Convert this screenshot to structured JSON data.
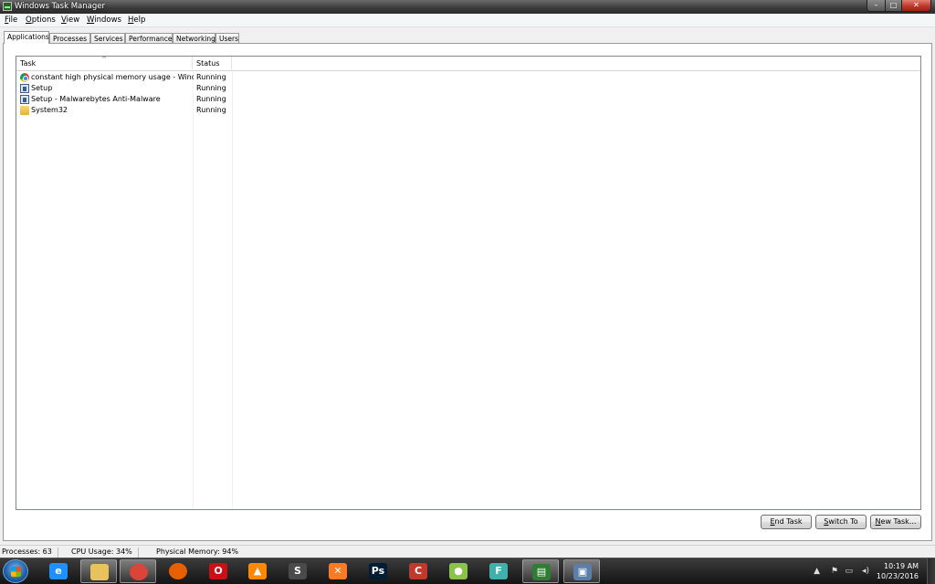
{
  "window": {
    "title": "Windows Task Manager",
    "controls": {
      "minimize": "–",
      "maximize": "□",
      "close": "✕"
    }
  },
  "menu": [
    "File",
    "Options",
    "View",
    "Windows",
    "Help"
  ],
  "tabs": [
    "Applications",
    "Processes",
    "Services",
    "Performance",
    "Networking",
    "Users"
  ],
  "active_tab": "Applications",
  "table": {
    "columns": [
      "Task",
      "Status"
    ],
    "sort_indicator": "^",
    "rows": [
      {
        "icon": "chrome-icon",
        "task": "constant high physical memory usage - Windows...",
        "status": "Running"
      },
      {
        "icon": "setup-icon",
        "task": "Setup",
        "status": "Running"
      },
      {
        "icon": "setup-icon",
        "task": "Setup - Malwarebytes Anti-Malware",
        "status": "Running"
      },
      {
        "icon": "folder-icon",
        "task": "System32",
        "status": "Running"
      }
    ]
  },
  "buttons": {
    "end_task": "End Task",
    "switch_to": "Switch To",
    "new_task": "New Task..."
  },
  "statusbar": {
    "processes": "Processes: 63",
    "cpu": "CPU Usage: 34%",
    "memory": "Physical Memory: 94%"
  },
  "taskbar": {
    "items": [
      {
        "name": "internet-explorer-icon",
        "glyph": "e",
        "color": "#1e90ff",
        "active": false
      },
      {
        "name": "file-explorer-icon",
        "glyph": "",
        "color": "#e8c25a",
        "active": true
      },
      {
        "name": "chrome-icon",
        "glyph": "",
        "color": "#db4437",
        "active": true
      },
      {
        "name": "firefox-icon",
        "glyph": "",
        "color": "#e66000",
        "active": false
      },
      {
        "name": "opera-icon",
        "glyph": "O",
        "color": "#cc0f16",
        "active": false
      },
      {
        "name": "vlc-icon",
        "glyph": "▲",
        "color": "#ff8800",
        "active": false
      },
      {
        "name": "sublime-text-icon",
        "glyph": "S",
        "color": "#4a4a4a",
        "active": false
      },
      {
        "name": "xampp-icon",
        "glyph": "✕",
        "color": "#fb7a24",
        "active": false
      },
      {
        "name": "photoshop-icon",
        "glyph": "Ps",
        "color": "#001d34",
        "active": false
      },
      {
        "name": "ccleaner-icon",
        "glyph": "C",
        "color": "#c0392b",
        "active": false
      },
      {
        "name": "app-green-icon",
        "glyph": "●",
        "color": "#8bc34a",
        "active": false
      },
      {
        "name": "app-f-icon",
        "glyph": "F",
        "color": "#3fb0ac",
        "active": false
      },
      {
        "name": "task-manager-icon",
        "glyph": "▤",
        "color": "#2e7d32",
        "active": true
      },
      {
        "name": "network-icon",
        "glyph": "▣",
        "color": "#5b7fa8",
        "active": true
      }
    ],
    "clock_time": "10:19 AM",
    "clock_date": "10/23/2016",
    "tray_icons": [
      "▲",
      "⚑",
      "▭",
      "◂)"
    ]
  }
}
